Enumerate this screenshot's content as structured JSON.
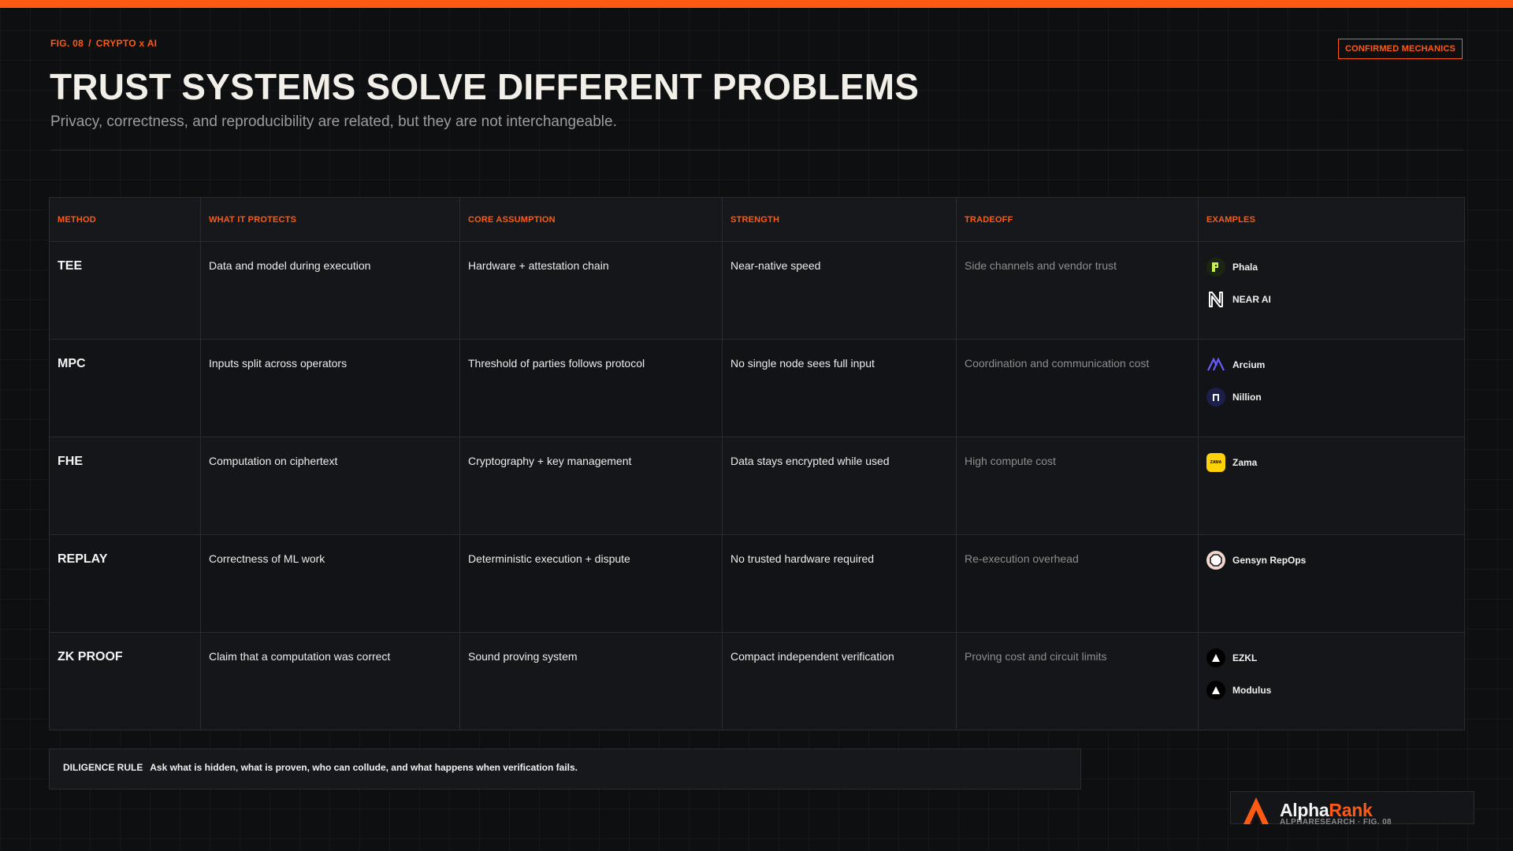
{
  "header": {
    "fig": "FIG. 08",
    "separator": "/",
    "section": "CRYPTO x AI",
    "badge": "CONFIRMED MECHANICS",
    "title": "TRUST SYSTEMS SOLVE DIFFERENT PROBLEMS",
    "subtitle": "Privacy, correctness, and reproducibility are related, but they are not interchangeable."
  },
  "table": {
    "columns": [
      "METHOD",
      "WHAT IT PROTECTS",
      "CORE ASSUMPTION",
      "STRENGTH",
      "TRADEOFF",
      "EXAMPLES"
    ],
    "rows": [
      {
        "method": "TEE",
        "protects": "Data and model during execution",
        "assumption": "Hardware + attestation chain",
        "strength": "Near-native speed",
        "tradeoff": "Side channels and vendor trust",
        "examples": [
          {
            "name": "Phala",
            "icon": "phala-logo-icon",
            "logo_color": "#c5f24a"
          },
          {
            "name": "NEAR AI",
            "icon": "near-logo-icon",
            "logo_color": "#ffffff"
          }
        ]
      },
      {
        "method": "MPC",
        "protects": "Inputs split across operators",
        "assumption": "Threshold of parties follows protocol",
        "strength": "No single node sees full input",
        "tradeoff": "Coordination and communication cost",
        "examples": [
          {
            "name": "Arcium",
            "icon": "arcium-logo-icon",
            "logo_color": "#6b5cff"
          },
          {
            "name": "Nillion",
            "icon": "nillion-logo-icon",
            "logo_color": "#1b1f4a"
          }
        ]
      },
      {
        "method": "FHE",
        "protects": "Computation on ciphertext",
        "assumption": "Cryptography + key management",
        "strength": "Data stays encrypted while used",
        "tradeoff": "High compute cost",
        "examples": [
          {
            "name": "Zama",
            "icon": "zama-logo-icon",
            "logo_color": "#ffd208",
            "logo_text": "ZAMA"
          }
        ]
      },
      {
        "method": "REPLAY",
        "protects": "Correctness of ML work",
        "assumption": "Deterministic execution + dispute",
        "strength": "No trusted hardware required",
        "tradeoff": "Re-execution overhead",
        "examples": [
          {
            "name": "Gensyn RepOps",
            "icon": "gensyn-logo-icon",
            "logo_color": "#f3d7cf"
          }
        ]
      },
      {
        "method": "ZK PROOF",
        "protects": "Claim that a computation was correct",
        "assumption": "Sound proving system",
        "strength": "Compact independent verification",
        "tradeoff": "Proving cost and circuit limits",
        "examples": [
          {
            "name": "EZKL",
            "icon": "ezkl-logo-icon",
            "logo_color": "#000000"
          },
          {
            "name": "Modulus",
            "icon": "modulus-logo-icon",
            "logo_color": "#000000"
          }
        ]
      }
    ]
  },
  "footer": {
    "rule_label": "DILIGENCE RULE",
    "rule_text": "Ask what is hidden, what is proven, who can collude, and what happens when verification fails.",
    "brand_name_a": "Alpha",
    "brand_name_b": "Rank",
    "brand_sub": "ALPHARESEARCH · FIG. 08",
    "accent": "#ff5a14"
  }
}
